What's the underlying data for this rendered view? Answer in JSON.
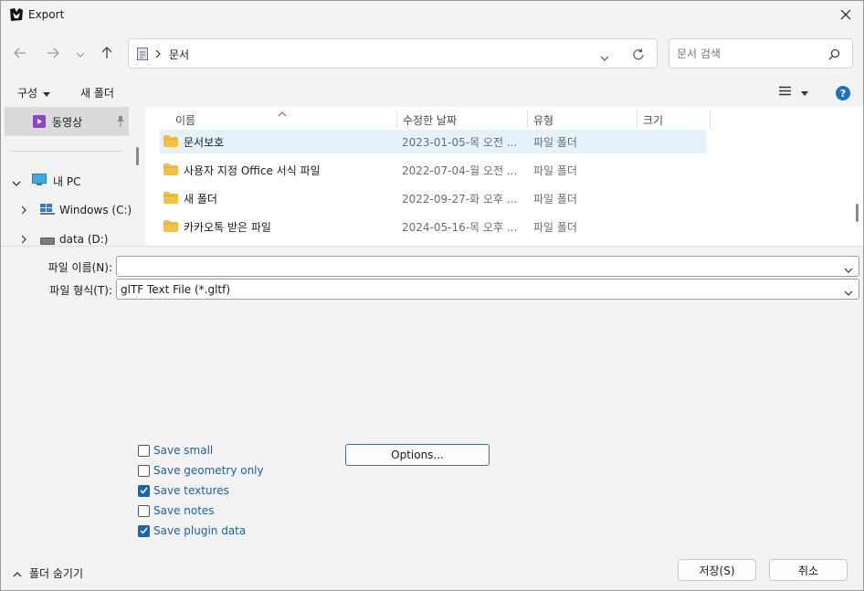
{
  "window": {
    "title": "Export",
    "close_icon": "close-icon"
  },
  "nav": {
    "back_icon": "arrow-left-icon",
    "forward_icon": "arrow-right-icon",
    "recent_icon": "chevron-down-icon",
    "up_icon": "arrow-up-icon"
  },
  "address": {
    "crumb": "문서",
    "refresh_icon": "refresh-icon"
  },
  "search": {
    "placeholder": "문서 검색"
  },
  "toolbar": {
    "organize_label": "구성",
    "new_folder_label": "새 폴더"
  },
  "sidebar": {
    "pinned_item": "동영상",
    "this_pc": "내 PC",
    "drives": [
      "Windows (C:)",
      "data (D:)"
    ]
  },
  "columns": {
    "name": "이름",
    "modified": "수정한 날짜",
    "type": "유형",
    "size": "크기"
  },
  "files": [
    {
      "name": "문서보호",
      "modified": "2023-01-05-목 오전 ...",
      "type": "파일 폴더",
      "size": ""
    },
    {
      "name": "사용자 지정 Office 서식 파일",
      "modified": "2022-07-04-월 오전 ...",
      "type": "파일 폴더",
      "size": ""
    },
    {
      "name": "새 폴더",
      "modified": "2022-09-27-화 오후 ...",
      "type": "파일 폴더",
      "size": ""
    },
    {
      "name": "카카오톡 받은 파일",
      "modified": "2024-05-16-목 오후 ...",
      "type": "파일 폴더",
      "size": ""
    }
  ],
  "form": {
    "filename_label": "파일 이름(N):",
    "filename_value": "",
    "filetype_label": "파일 형식(T):",
    "filetype_value": "glTF Text File (*.gltf)"
  },
  "options": {
    "save_small": {
      "label": "Save small",
      "checked": false
    },
    "save_geometry_only": {
      "label": "Save geometry only",
      "checked": false
    },
    "save_textures": {
      "label": "Save textures",
      "checked": true
    },
    "save_notes": {
      "label": "Save notes",
      "checked": false
    },
    "save_plugin_data": {
      "label": "Save plugin data",
      "checked": true
    },
    "options_button": "Options..."
  },
  "footer": {
    "hide_folders": "폴더 숨기기",
    "save_button": "저장(S)",
    "cancel_button": "취소"
  },
  "colors": {
    "accent": "#1565c0",
    "link_text": "#1f5ea8",
    "selection": "#e5f1fb",
    "folder": "#f4c143"
  }
}
